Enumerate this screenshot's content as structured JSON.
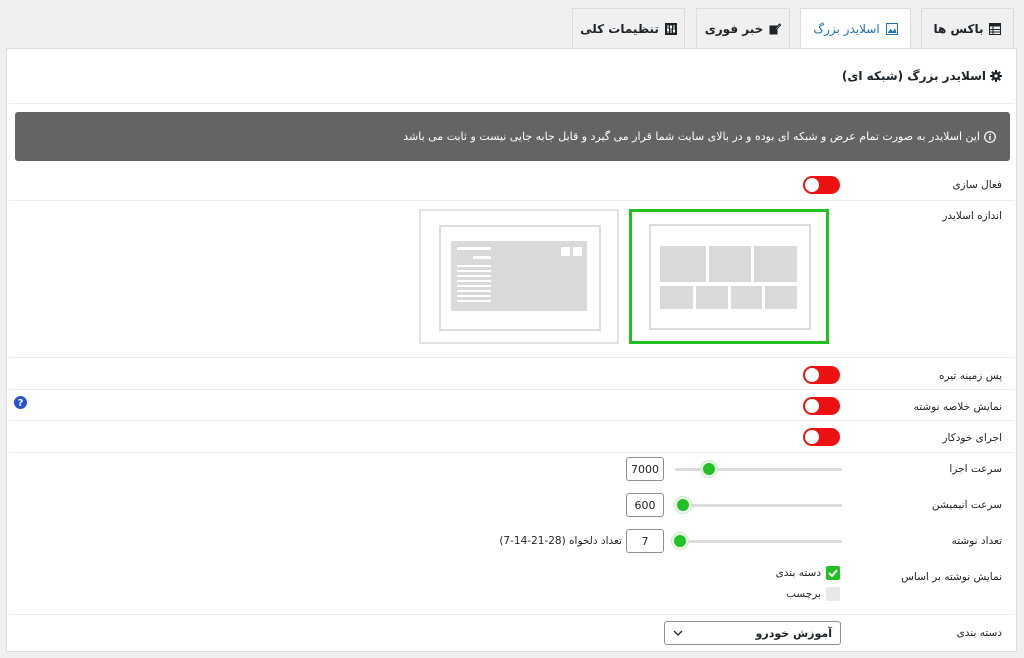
{
  "tabs": [
    {
      "label": "باکس ها",
      "icon": "table-icon"
    },
    {
      "label": "اسلایدر بزرگ",
      "icon": "image-icon",
      "active": true
    },
    {
      "label": "خبر فوری",
      "icon": "pen-icon"
    },
    {
      "label": "تنظیمات کلی",
      "icon": "sliders-icon"
    }
  ],
  "panel": {
    "title": "اسلایدر بزرگ (شبکه ای)",
    "notice": "این اسلایدر به صورت تمام عرض و شبکه ای بوده و در بالای سایت شما قرار می گیرد و قابل جابه جایی نیست و ثابت می باشد"
  },
  "fields": {
    "activate": {
      "label": "فعال سازی",
      "on": false
    },
    "slider_size": {
      "label": "اندازه اسلایدر",
      "selected": "grid"
    },
    "dark_bg": {
      "label": "پس زمینه تیره",
      "on": false
    },
    "excerpt": {
      "label": "نمایش خلاصه نوشته",
      "on": false
    },
    "autoplay": {
      "label": "اجرای خودکار",
      "on": false
    },
    "speed": {
      "label": "سرعت اجرا",
      "value": "7000",
      "fraction": 0.22
    },
    "anim_speed": {
      "label": "سرعت انیمیشن",
      "value": "600",
      "fraction": 0.06
    },
    "post_count": {
      "label": "تعداد نوشته",
      "value": "7",
      "fraction": 0.04,
      "hint": "تعداد دلخواه (28-21-14-7)"
    },
    "show_by": {
      "label": "نمایش نوشته بر اساس",
      "options": [
        {
          "label": "دسته بندی",
          "checked": true
        },
        {
          "label": "برچسب",
          "checked": false
        }
      ]
    },
    "category": {
      "label": "دسته بندی",
      "value": "آموزش خودرو"
    }
  },
  "colors": {
    "accent_green": "#22c022",
    "toggle_off": "#ee1111",
    "notice_bg": "#646464",
    "tab_active_text": "#2271b1"
  }
}
